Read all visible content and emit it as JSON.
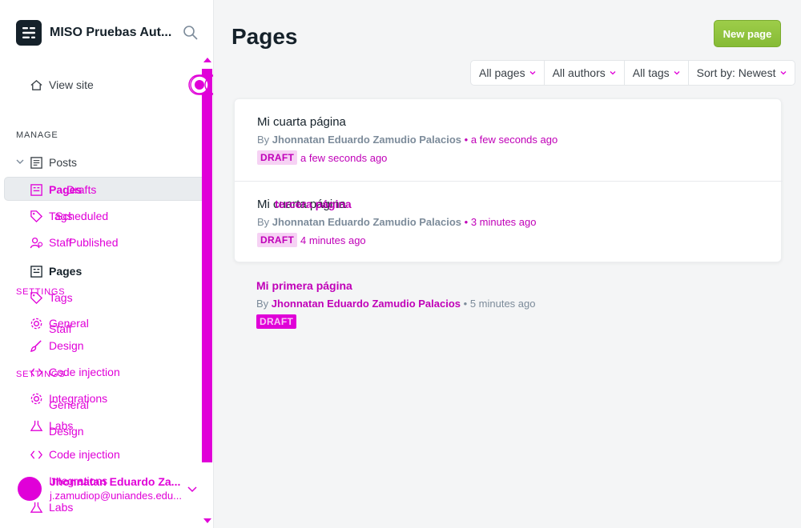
{
  "sidebar": {
    "brand_title": "MISO Pruebas Aut...",
    "view_site": "View site",
    "manage_label": "MANAGE",
    "posts": "Posts",
    "drafts": "Drafts",
    "scheduled": "Scheduled",
    "published": "Published",
    "pages": "Pages",
    "tags": "Tags",
    "staff": "Staff",
    "settings_label": "SETTINGS",
    "general": "General",
    "design": "Design",
    "code_injection": "Code injection",
    "integrations": "Integrations",
    "labs": "Labs",
    "ghost_pages": "Pages",
    "ghost_tags": "Tags",
    "ghost_staff": "Staff",
    "user_name": "Jhonnatan Eduardo Za...",
    "user_email": "j.zamudiop@uniandes.edu..."
  },
  "main": {
    "title": "Pages",
    "new_page": "New page",
    "filters": [
      "All pages",
      "All authors",
      "All tags",
      "Sort by: Newest"
    ],
    "items": [
      {
        "title": "Mi cuarta página",
        "by": "By",
        "author": "Jhonnatan Eduardo Zamudio Palacios",
        "sep": "•",
        "time": "a few seconds ago",
        "status": "DRAFT",
        "status_time": "a few seconds ago"
      },
      {
        "title": "Mi cuarta página",
        "overlay_title": "tercera página",
        "by": "By",
        "author": "Jhonnatan Eduardo Zamudio Palacios",
        "sep": "•",
        "time": "3 minutes ago",
        "status": "DRAFT",
        "status_time": "4 minutes ago"
      },
      {
        "title": "Mi primera página",
        "by": "By",
        "author": "Jhonnatan Eduardo Zamudio Palacios",
        "sep": "•",
        "time": "5 minutes ago",
        "status": "DRAFT"
      }
    ]
  },
  "colors": {
    "accent_green": "#8ac03a",
    "artifact_magenta": "#e000d8",
    "text_dark": "#15212a"
  }
}
